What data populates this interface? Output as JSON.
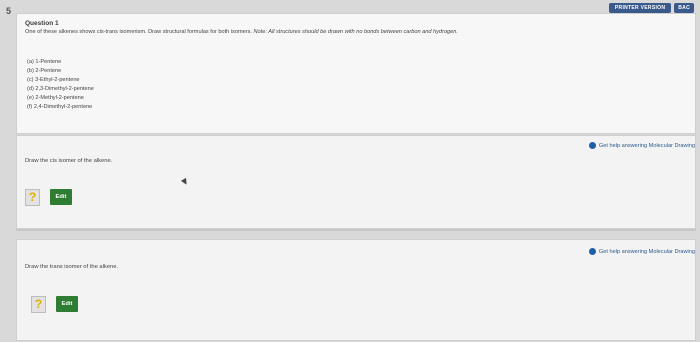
{
  "page_number": "5",
  "top_buttons": {
    "printer_version": "PRINTER VERSION",
    "back": "BAC"
  },
  "question": {
    "title": "Question 1",
    "text_main": "One of these alkenes shows cis-trans isomerism. Draw structural formulas for both isomers. ",
    "text_note": "Note: All structures should be drawn with no bonds between carbon and hydrogen.",
    "options": [
      "(a) 1-Pentene",
      "(b) 2-Pentene",
      "(c) 3-Ethyl-2-pentene",
      "(d) 2,3-Dimethyl-2-pentene",
      "(e) 2-Methyl-2-pentene",
      "(f) 2,4-Dimethyl-2-pentene"
    ]
  },
  "part_cis": {
    "help_text": "Get help answering Molecular Drawing",
    "prompt": "Draw the cis isomer of the alkene.",
    "qmark": "?",
    "edit_label": "Edit"
  },
  "part_trans": {
    "help_text": "Get help answering Molecular Drawing",
    "prompt": "Draw the trans isomer of the alkene.",
    "qmark": "?",
    "edit_label": "Edit"
  },
  "colors": {
    "edit_green": "#2f7d32",
    "help_blue": "#1f5fa8",
    "qmark_yellow": "#e0b000"
  }
}
